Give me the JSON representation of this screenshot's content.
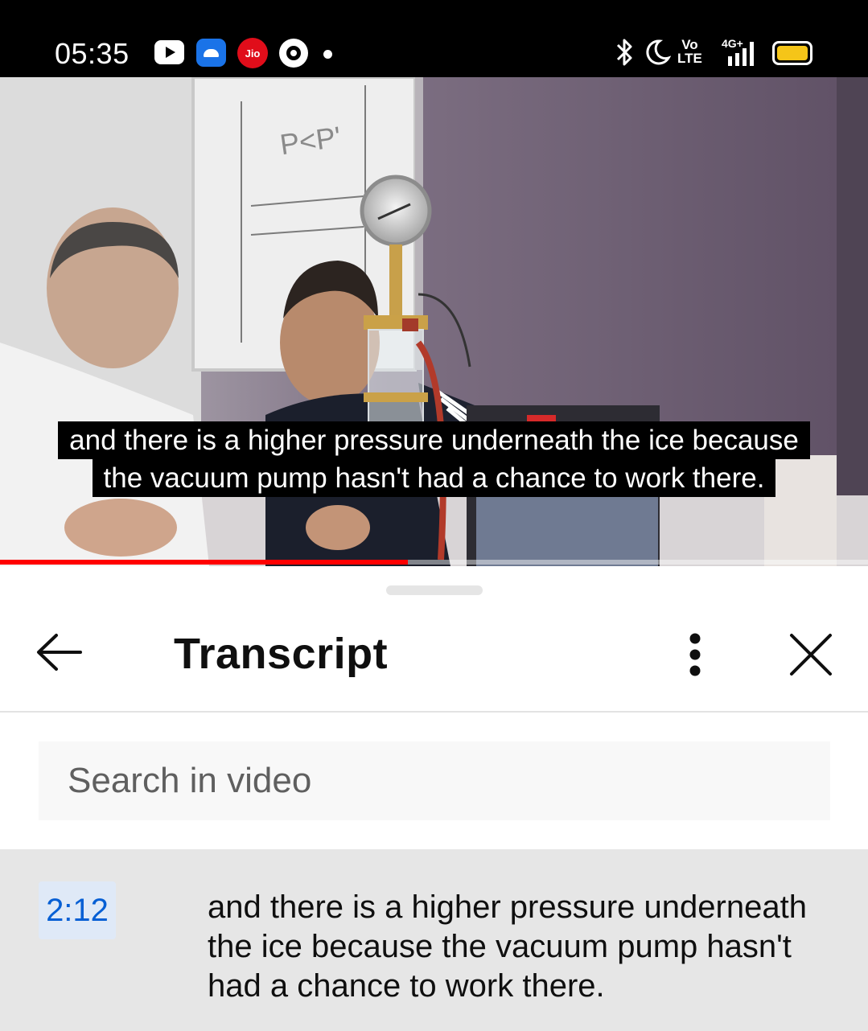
{
  "status_bar": {
    "time": "05:35",
    "jio_label": "Jio",
    "volte_top": "Vo",
    "volte_bottom": "LTE",
    "network": "4G+",
    "icons": [
      "youtube-notification-icon",
      "android-notification-icon",
      "jio-notification-icon",
      "pinwheel-notification-icon",
      "more-notifications-dot",
      "bluetooth-icon",
      "do-not-disturb-moon-icon",
      "volte-icon",
      "signal-icon",
      "battery-icon"
    ]
  },
  "video": {
    "whiteboard_text": "P<P'",
    "captions": [
      "and there is a higher pressure underneath the ice because",
      "the vacuum pump hasn't had a chance to work there."
    ],
    "progress_fraction": 0.47
  },
  "transcript": {
    "title": "Transcript",
    "search_placeholder": "Search in video",
    "icons": [
      "back-arrow-icon",
      "more-vert-icon",
      "close-icon"
    ],
    "segments": [
      {
        "time": "2:12",
        "text": "and there is a higher pressure underneath the ice because the vacuum pump hasn't had a chance to work there."
      }
    ]
  },
  "colors": {
    "progress": "#ff0000",
    "timestamp_link": "#065fd4",
    "active_segment_bg": "#e6e6e6",
    "battery": "#f5c518"
  }
}
